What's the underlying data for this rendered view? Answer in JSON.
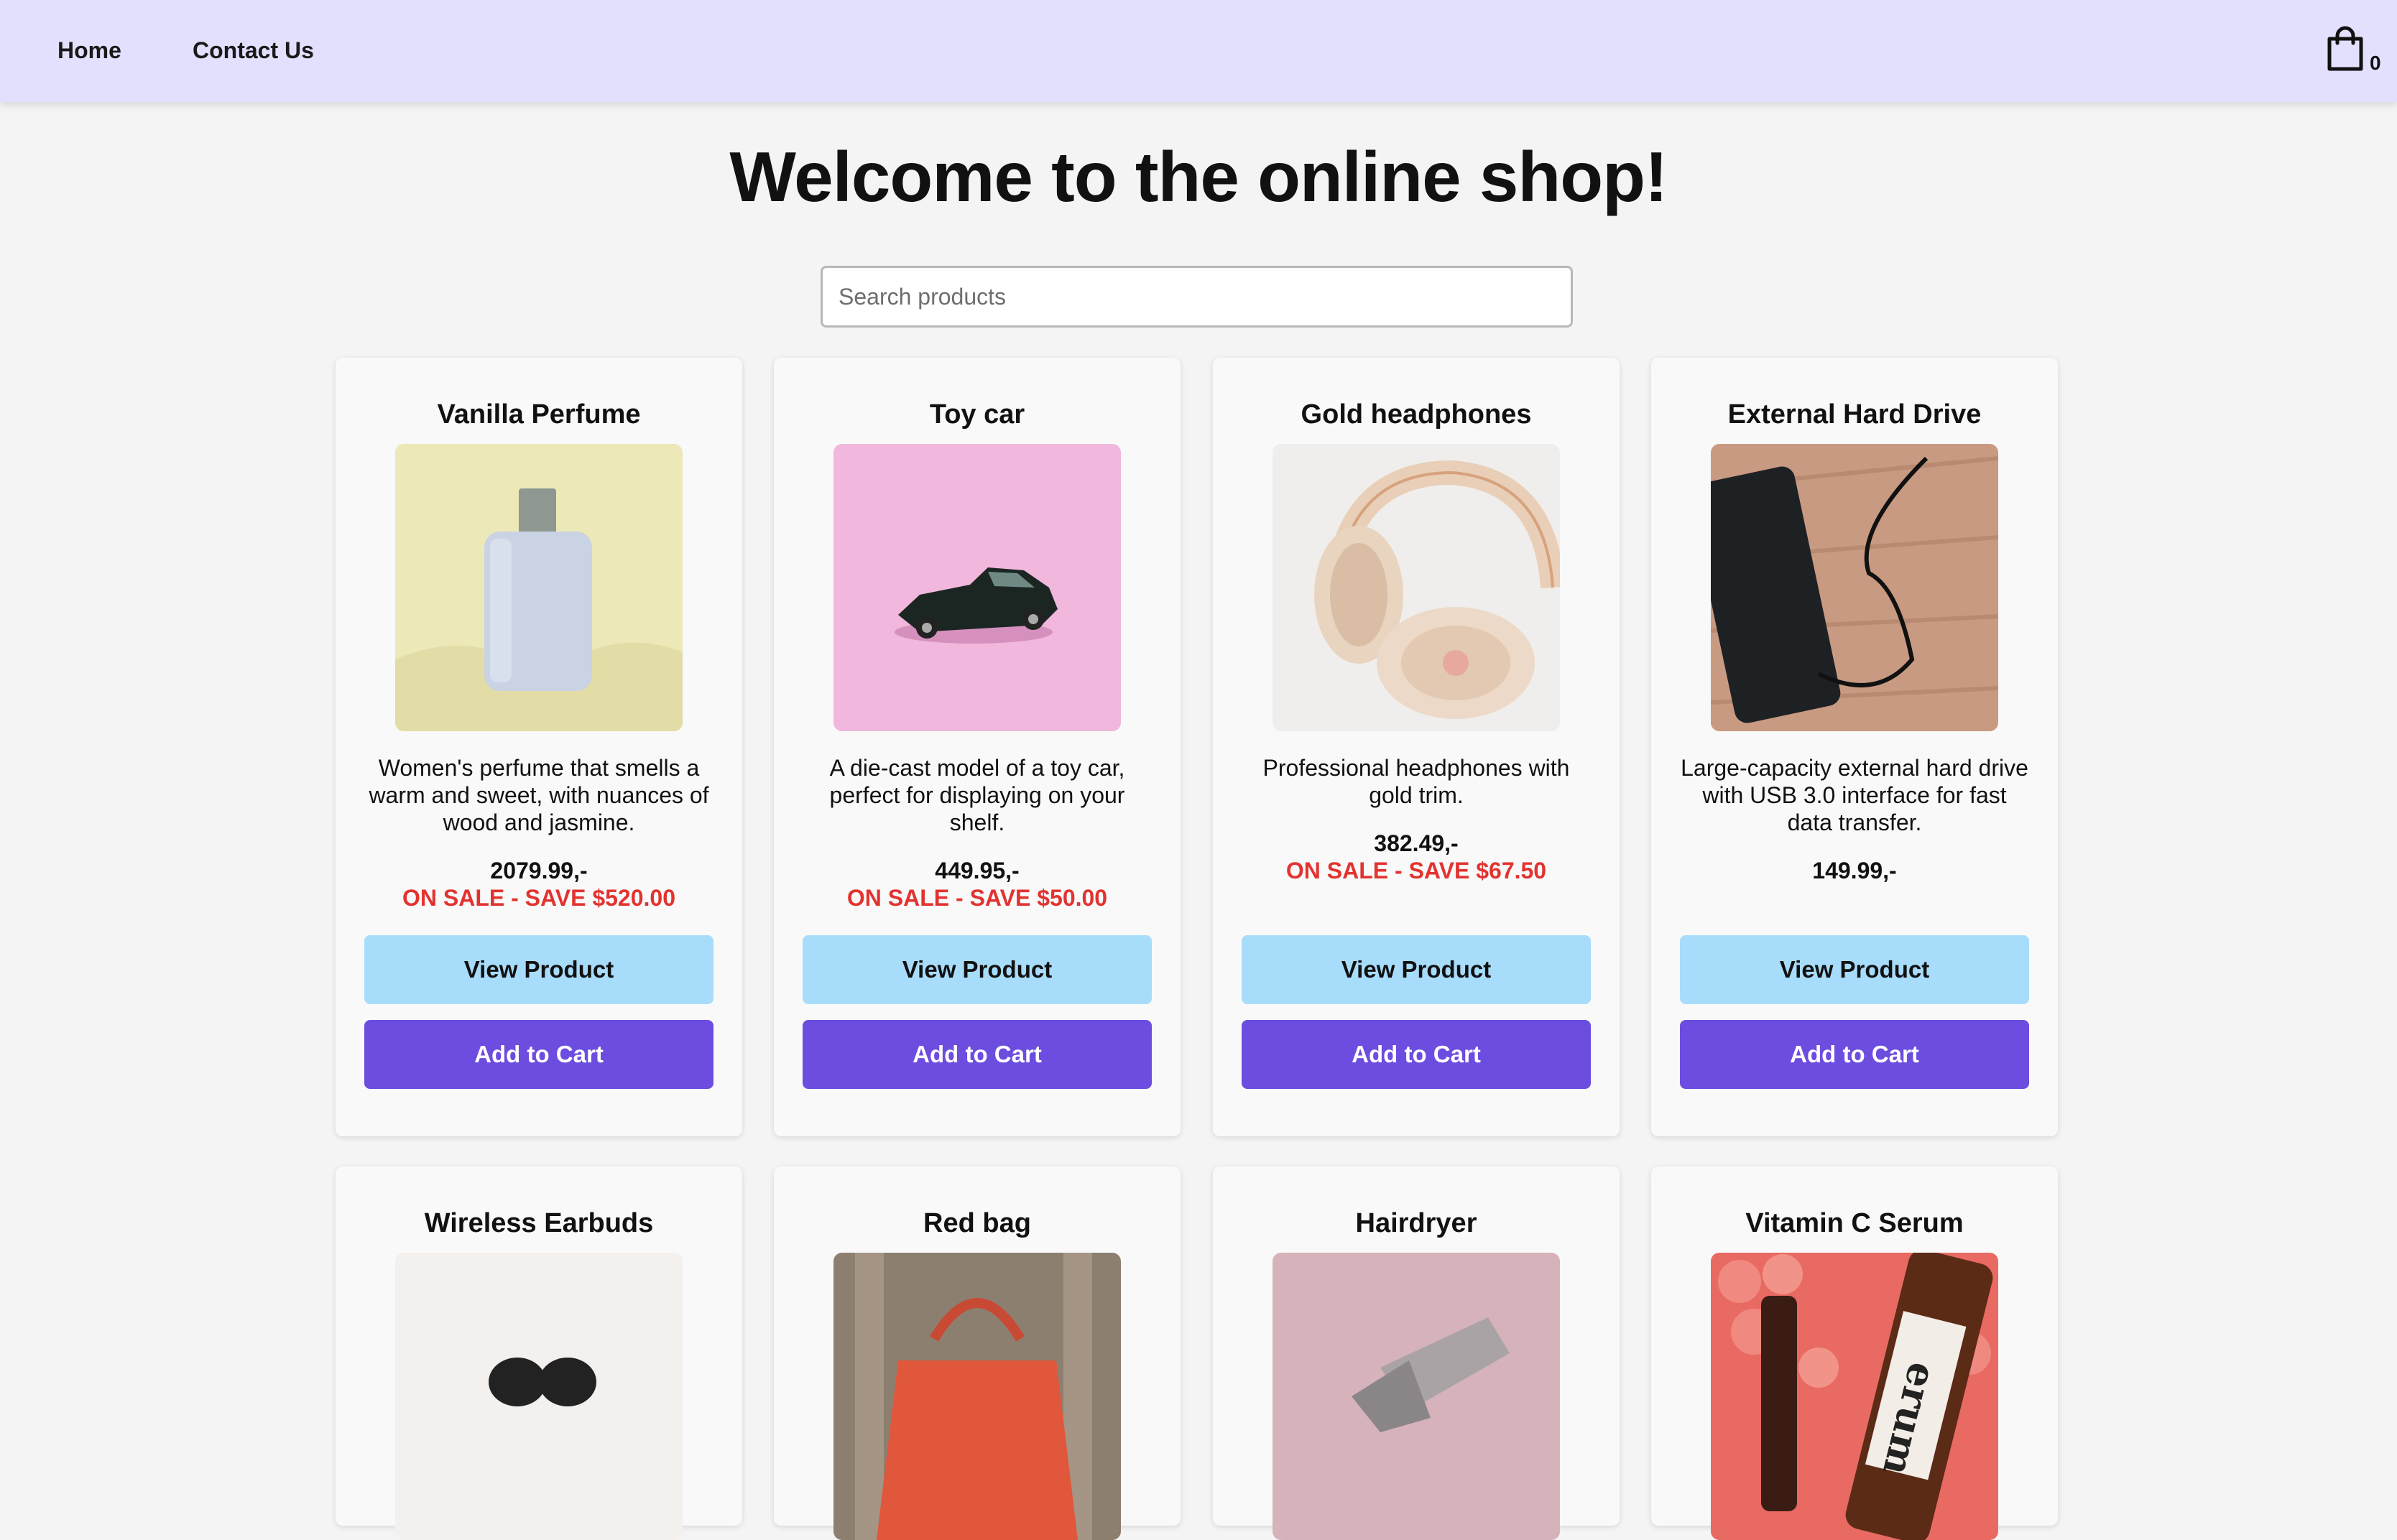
{
  "nav": {
    "home": "Home",
    "contact": "Contact Us",
    "cart_count": "0"
  },
  "main": {
    "title": "Welcome to the online shop!",
    "search_placeholder": "Search products"
  },
  "buttons": {
    "view": "View Product",
    "add": "Add to Cart"
  },
  "products": [
    {
      "name": "Vanilla Perfume",
      "description": "Women's perfume that smells a warm and sweet, with nuances of wood and jasmine.",
      "price": "2079.99,-",
      "sale": "ON SALE - SAVE $520.00"
    },
    {
      "name": "Toy car",
      "description": "A die-cast model of a toy car, perfect for displaying on your shelf.",
      "price": "449.95,-",
      "sale": "ON SALE - SAVE $50.00"
    },
    {
      "name": "Gold headphones",
      "description": "Professional headphones with gold trim.",
      "price": "382.49,-",
      "sale": "ON SALE - SAVE $67.50"
    },
    {
      "name": "External Hard Drive",
      "description": "Large-capacity external hard drive with USB 3.0 interface for fast data transfer.",
      "price": "149.99,-",
      "sale": ""
    },
    {
      "name": "Wireless Earbuds"
    },
    {
      "name": "Red bag"
    },
    {
      "name": "Hairdryer"
    },
    {
      "name": "Vitamin C Serum",
      "image_text": "erum"
    }
  ],
  "colors": {
    "header_bg": "#e2e0fd",
    "view_button": "#a8dcfb",
    "add_button": "#6c4ddf",
    "sale_text": "#e23330"
  }
}
